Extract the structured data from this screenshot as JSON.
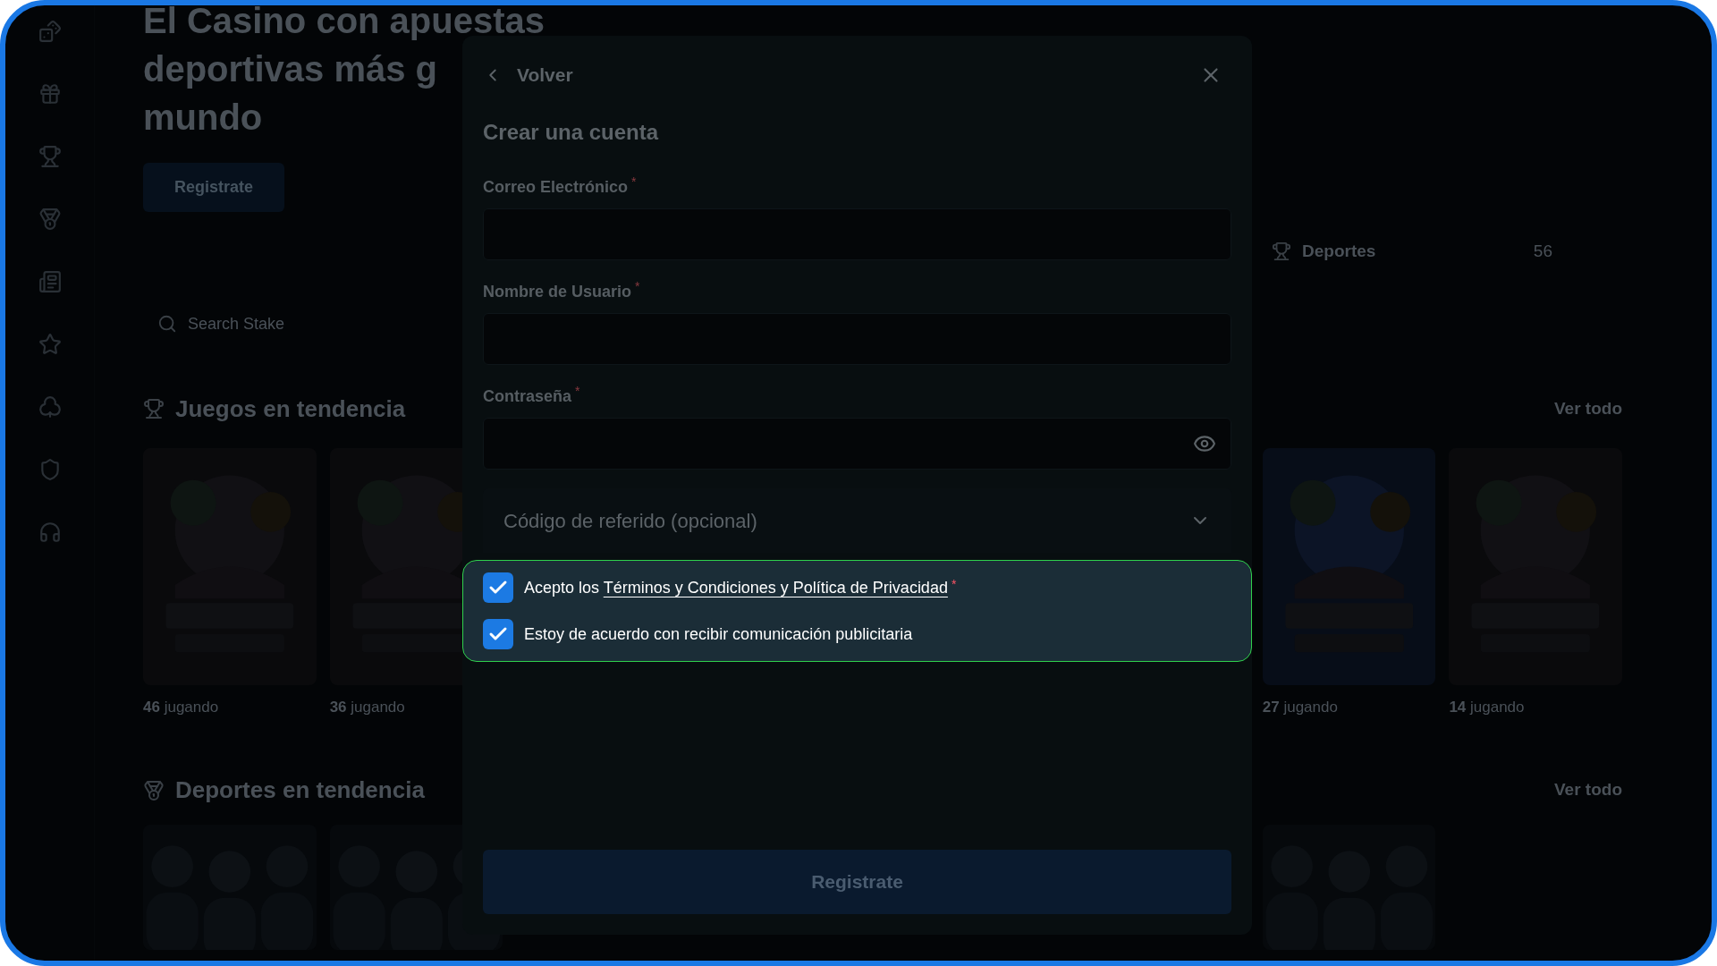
{
  "hero": {
    "title_lines": [
      "El Casino con apuestas",
      "deportivas más g",
      "mundo"
    ],
    "button": "Registrate"
  },
  "search": {
    "placeholder": "Search Stake"
  },
  "sports_summary": {
    "label": "Deportes",
    "count": "56"
  },
  "games_section": {
    "title": "Juegos en tendencia",
    "link": "Ver todo",
    "cards_left": [
      {
        "players": "**46** jugando"
      },
      {
        "players": "**36** jugando"
      }
    ],
    "cards_right": [
      {
        "players": "**27** jugando"
      },
      {
        "players": "**14** jugando"
      }
    ]
  },
  "sports_section": {
    "title": "Deportes en tendencia",
    "link": "Ver todo"
  },
  "modal": {
    "back": "Volver",
    "title": "Crear una cuenta",
    "fields": [
      {
        "label": "Correo Electrónico",
        "required_mark": "*",
        "kind": "text"
      },
      {
        "label": "Nombre de Usuario",
        "required_mark": "*",
        "kind": "text"
      },
      {
        "label": "Contraseña",
        "required_mark": "*",
        "kind": "password"
      }
    ],
    "referral": {
      "label": "Código de referido (opcional)",
      "expanded": false
    },
    "consents": [
      {
        "text": "Acepto los ",
        "link": "Términos y Condiciones y Política de Privacidad",
        "required_mark": "*",
        "checked": true
      },
      {
        "text": "Estoy de acuerdo con recibir comunicación publicitaria",
        "checked": true
      }
    ],
    "submit": "Registrate"
  }
}
